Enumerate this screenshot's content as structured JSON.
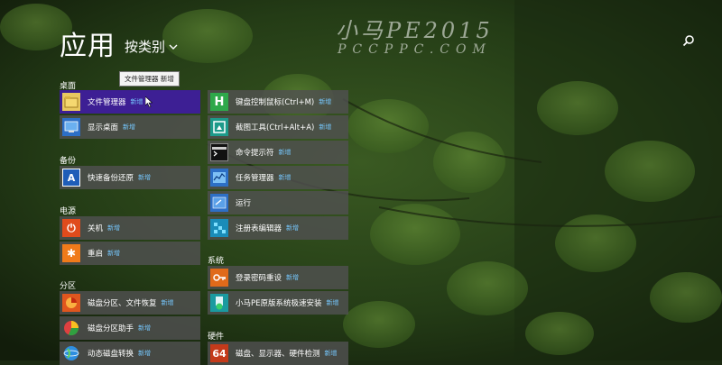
{
  "header": {
    "title": "应用",
    "sort_label": "按类别",
    "watermark_line1": "小马PE2015",
    "watermark_line2": "PCCPPC.COM"
  },
  "tooltip": "文件管理器 新增",
  "new_badge": "新增",
  "groups": {
    "desktop": "桌面",
    "backup": "备份",
    "power": "电源",
    "partition": "分区",
    "system": "系统",
    "hardware": "硬件"
  },
  "apps": {
    "file_manager": "文件管理器",
    "show_desktop": "显示桌面",
    "quick_backup": "快速备份还原",
    "shutdown": "关机",
    "restart": "重启",
    "disk_partition": "磁盘分区、文件恢复",
    "partition_assistant": "磁盘分区助手",
    "dynamic_disk": "动态磁盘转换",
    "keyboard_mouse": "键盘控制鼠标(Ctrl+M)",
    "screenshot": "截图工具(Ctrl+Alt+A)",
    "cmd": "命令提示符",
    "task_manager": "任务管理器",
    "run": "运行",
    "regedit": "注册表编辑器",
    "password_reset": "登录密码重设",
    "xiaoma_install": "小马PE原版系统极速安装",
    "hw_detect": "磁盘、显示器、硬件检测"
  },
  "icon_text": {
    "keyboard_mouse": "H",
    "quick_backup": "A",
    "hw_detect": "64",
    "shutdown": "⏻",
    "restart": "✱"
  },
  "colors": {
    "tile_bg": "#505050",
    "tile_selected": "#3d1f94",
    "new_badge": "#76c8ff"
  }
}
